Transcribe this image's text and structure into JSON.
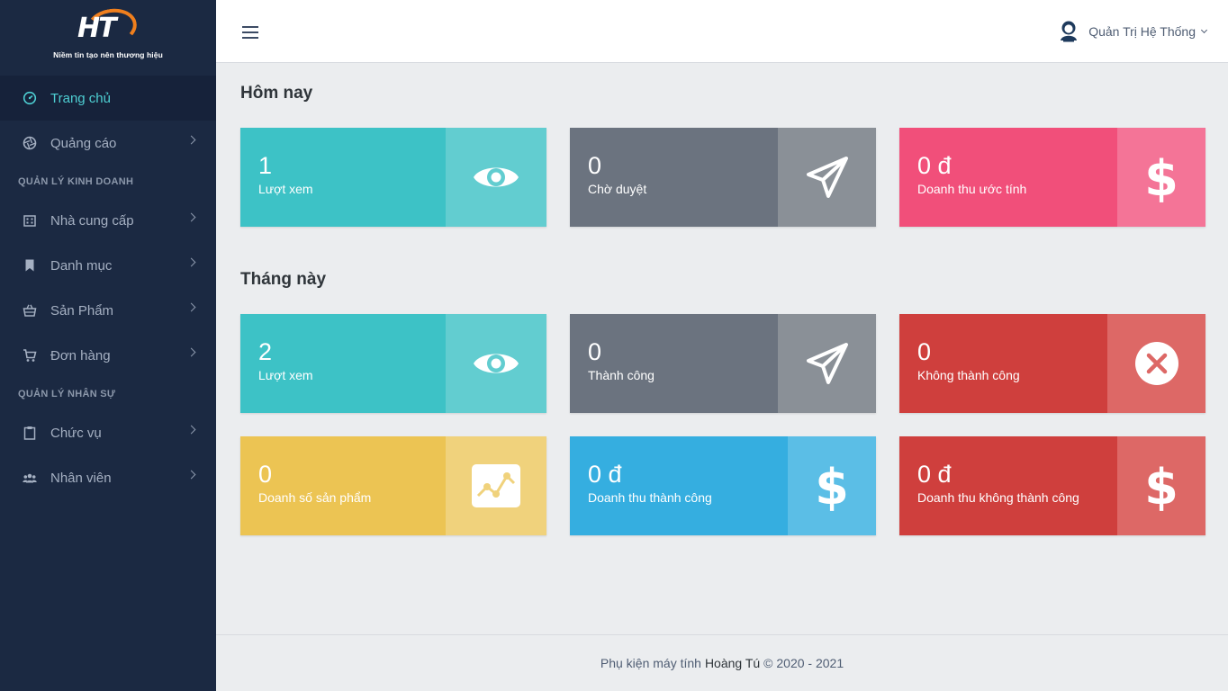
{
  "brand": {
    "logo_text": "HT",
    "tagline": "Niềm tin tạo nên thương hiệu"
  },
  "sidebar": {
    "items": [
      {
        "label": "Trang chủ",
        "icon": "dashboard-icon",
        "active": true
      },
      {
        "label": "Quảng cáo",
        "icon": "aperture-icon"
      }
    ],
    "section_business": "QUẢN LÝ KINH DOANH",
    "business_items": [
      {
        "label": "Nhà cung cấp",
        "icon": "building-icon"
      },
      {
        "label": "Danh mục",
        "icon": "bookmark-icon"
      },
      {
        "label": "Sản Phẩm",
        "icon": "basket-icon"
      },
      {
        "label": "Đơn hàng",
        "icon": "cart-icon"
      }
    ],
    "section_staff": "QUẢN LÝ NHÂN SỰ",
    "staff_items": [
      {
        "label": "Chức vụ",
        "icon": "clipboard-icon"
      },
      {
        "label": "Nhân viên",
        "icon": "people-icon"
      }
    ]
  },
  "header": {
    "user_name": "Quản Trị Hệ Thống",
    "avatar_icon": "user-avatar-icon"
  },
  "today": {
    "title": "Hôm nay",
    "cards": [
      {
        "value": "1",
        "label": "Lượt xem",
        "icon": "eye-icon",
        "color": "#3dc2c6",
        "accent": "#62cdd0"
      },
      {
        "value": "0",
        "label": "Chờ duyệt",
        "icon": "paper-plane-icon",
        "color": "#6b737f",
        "accent": "#8a9097"
      },
      {
        "value": "0 đ",
        "label": "Doanh thu ước tính",
        "icon": "dollar-icon",
        "color": "#f14f7a",
        "accent": "#f47497"
      }
    ]
  },
  "month": {
    "title": "Tháng này",
    "cards": [
      {
        "value": "2",
        "label": "Lượt xem",
        "icon": "eye-icon",
        "color": "#3dc2c6",
        "accent": "#62cdd0"
      },
      {
        "value": "0",
        "label": "Thành công",
        "icon": "paper-plane-icon",
        "color": "#6b737f",
        "accent": "#8a9097"
      },
      {
        "value": "0",
        "label": "Không thành công",
        "icon": "x-circle-icon",
        "color": "#cf3f3d",
        "accent": "#dd6866"
      },
      {
        "value": "0",
        "label": "Doanh số sản phẩm",
        "icon": "line-chart-icon",
        "color": "#ecc453",
        "accent": "#f0d27c"
      },
      {
        "value": "0 đ",
        "label": "Doanh thu thành công",
        "icon": "dollar-icon",
        "color": "#35aee0",
        "accent": "#5bbee6"
      },
      {
        "value": "0 đ",
        "label": "Doanh thu không thành công",
        "icon": "dollar-icon",
        "color": "#cf3f3d",
        "accent": "#dd6866"
      }
    ]
  },
  "footer": {
    "prefix": "Phụ kiện máy tính",
    "brand": "Hoàng Tú",
    "suffix": "© 2020 - 2021"
  }
}
